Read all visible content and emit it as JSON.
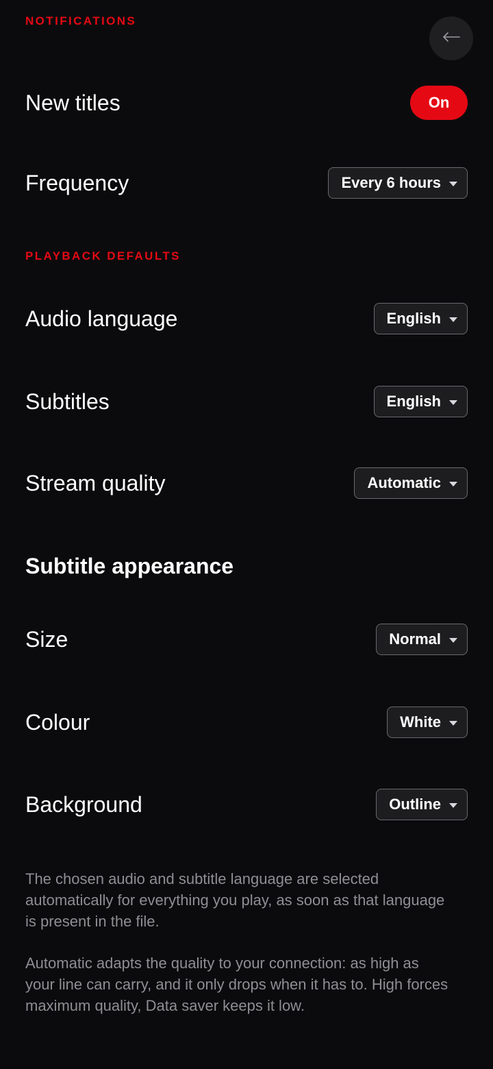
{
  "notifications": {
    "section_title": "NOTIFICATIONS",
    "new_titles": {
      "label": "New titles",
      "toggle_label": "On"
    },
    "frequency": {
      "label": "Frequency",
      "value": "Every 6 hours"
    }
  },
  "playback_defaults": {
    "section_title": "PLAYBACK DEFAULTS",
    "audio_language": {
      "label": "Audio language",
      "value": "English"
    },
    "subtitles": {
      "label": "Subtitles",
      "value": "English"
    },
    "stream_quality": {
      "label": "Stream quality",
      "value": "Automatic"
    }
  },
  "subtitle_appearance": {
    "heading": "Subtitle appearance",
    "size": {
      "label": "Size",
      "value": "Normal"
    },
    "colour": {
      "label": "Colour",
      "value": "White"
    },
    "background": {
      "label": "Background",
      "value": "Outline"
    }
  },
  "notes": {
    "language_note": "The chosen audio and subtitle language are selected automatically for everything you play, as soon as that language is present in the file.",
    "quality_note": "Automatic adapts the quality to your connection: as high as your line can carry, and it only drops when it has to. High forces maximum quality, Data saver keeps it low."
  },
  "icons": {
    "back": "arrow-left-icon",
    "dropdown": "caret-down-icon"
  },
  "colors": {
    "accent": "#e50914",
    "background": "#0b0b0d",
    "muted_text": "#8e8e93"
  }
}
